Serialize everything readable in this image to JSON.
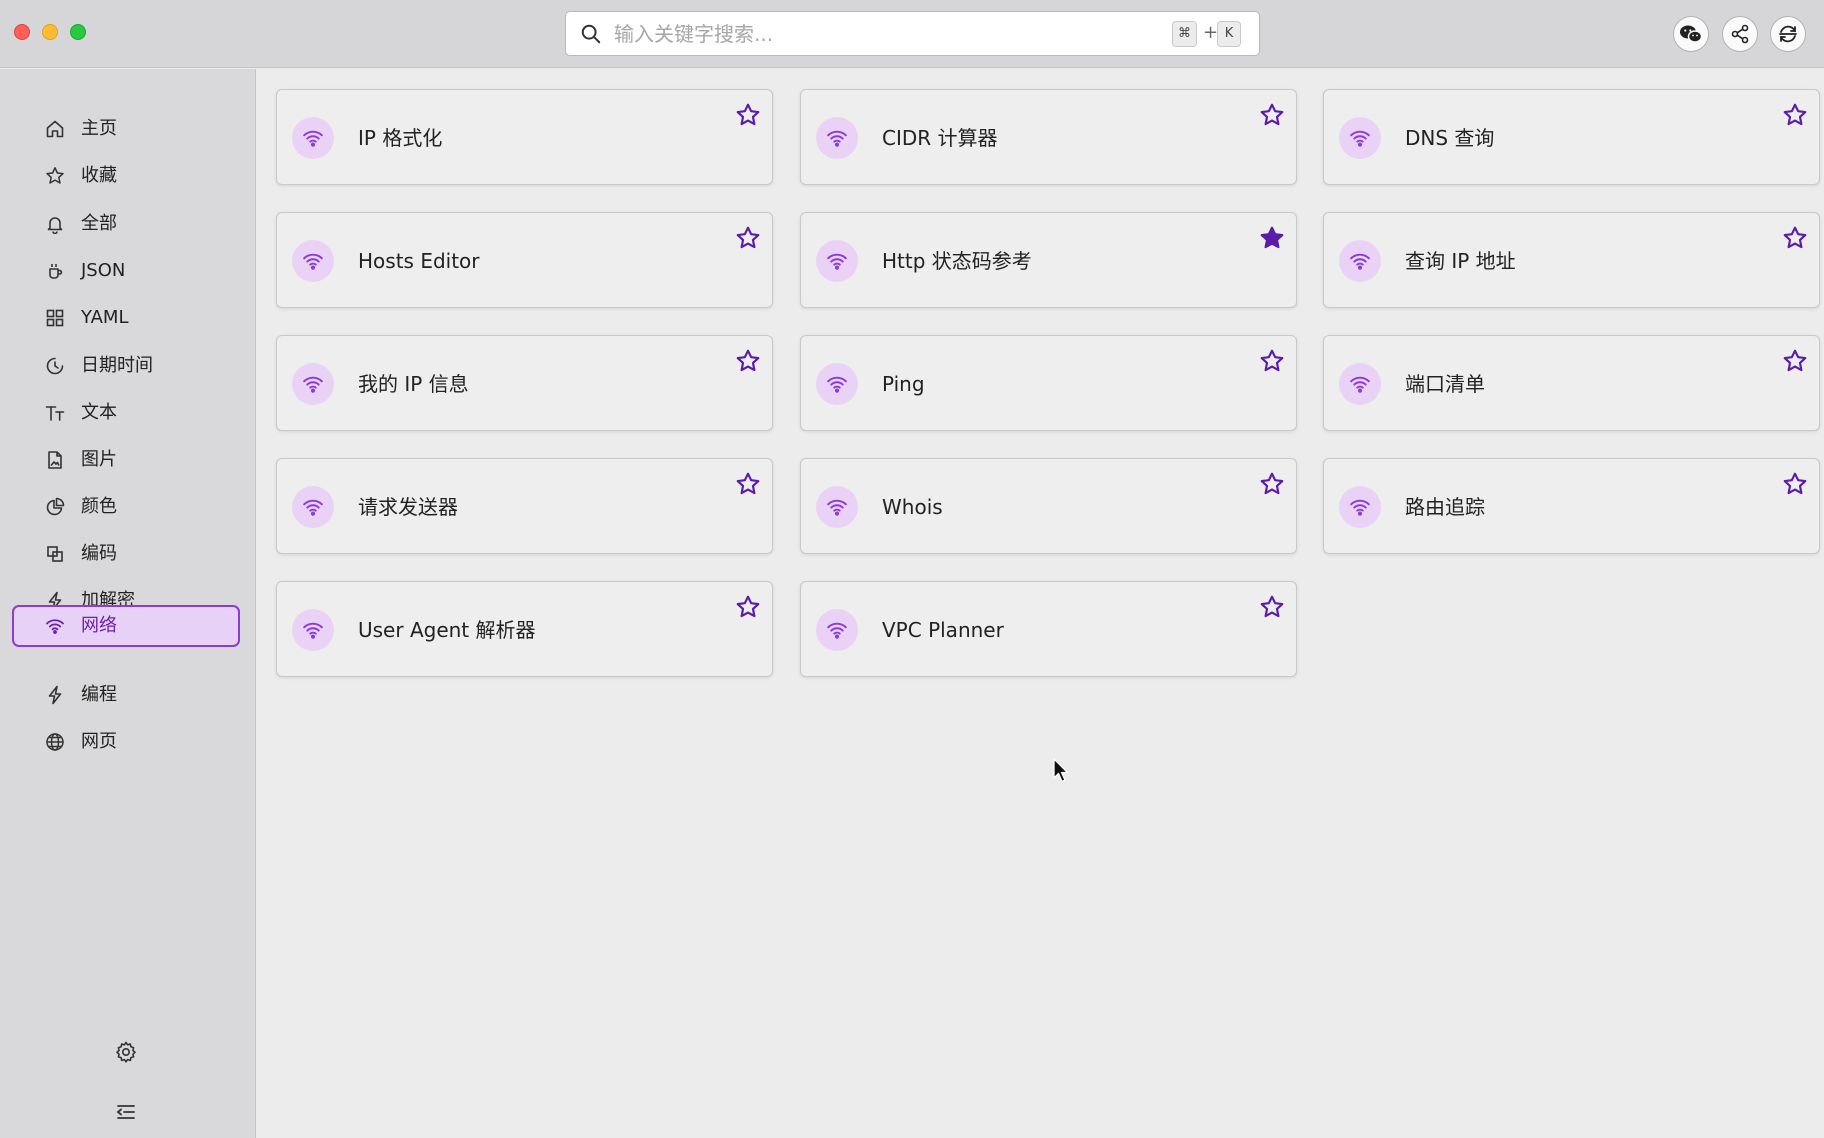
{
  "search": {
    "placeholder": "输入关键字搜索...",
    "shortcut_cmd": "⌘",
    "shortcut_plus": "+",
    "shortcut_key": "K"
  },
  "colors": {
    "accent": "#8b3bd6",
    "star": "#5b1ca8",
    "icon_bg": "#ead2f6"
  },
  "sidebar": {
    "items": [
      {
        "label": "主页",
        "icon": "home-icon"
      },
      {
        "label": "收藏",
        "icon": "star-icon"
      },
      {
        "label": "全部",
        "icon": "bell-icon"
      },
      {
        "label": "JSON",
        "icon": "json-icon"
      },
      {
        "label": "YAML",
        "icon": "grid-icon"
      },
      {
        "label": "日期时间",
        "icon": "clock-icon"
      },
      {
        "label": "文本",
        "icon": "text-icon"
      },
      {
        "label": "图片",
        "icon": "image-file-icon"
      },
      {
        "label": "颜色",
        "icon": "pie-icon"
      },
      {
        "label": "编码",
        "icon": "copy-icon"
      },
      {
        "label": "加解密",
        "icon": "bolt-icon"
      },
      {
        "label": "网络",
        "icon": "wifi-icon",
        "active": true
      },
      {
        "label": "编程",
        "icon": "bolt-icon"
      },
      {
        "label": "网页",
        "icon": "globe-icon"
      }
    ],
    "settings_icon": "gear-icon",
    "collapse_icon": "collapse-menu-icon"
  },
  "main": {
    "tools": [
      {
        "title": "IP 格式化",
        "favorited": false
      },
      {
        "title": "CIDR 计算器",
        "favorited": false
      },
      {
        "title": "DNS 查询",
        "favorited": false
      },
      {
        "title": "Hosts Editor",
        "favorited": false
      },
      {
        "title": "Http 状态码参考",
        "favorited": true
      },
      {
        "title": "查询 IP 地址",
        "favorited": false
      },
      {
        "title": "我的 IP 信息",
        "favorited": false
      },
      {
        "title": "Ping",
        "favorited": false
      },
      {
        "title": "端口清单",
        "favorited": false
      },
      {
        "title": "请求发送器",
        "favorited": false
      },
      {
        "title": "Whois",
        "favorited": false
      },
      {
        "title": "路由追踪",
        "favorited": false
      },
      {
        "title": "User Agent 解析器",
        "favorited": false
      },
      {
        "title": "VPC Planner",
        "favorited": false
      }
    ]
  }
}
